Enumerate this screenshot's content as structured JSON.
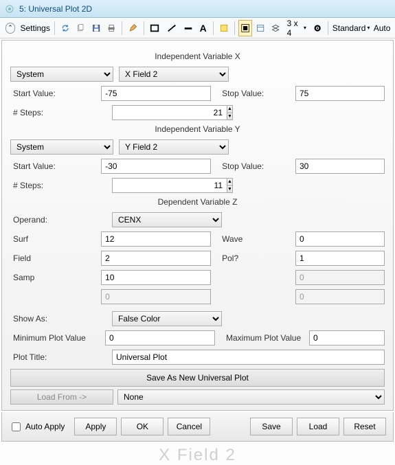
{
  "window": {
    "title": "5: Universal Plot 2D"
  },
  "toolbar": {
    "settings": "Settings",
    "grid_text": "3 x 4",
    "standard": "Standard",
    "auto": "Auto"
  },
  "varX": {
    "title": "Independent Variable X",
    "source": "System",
    "field": "X Field 2",
    "start_label": "Start Value:",
    "start": "-75",
    "stop_label": "Stop Value:",
    "stop": "75",
    "steps_label": "# Steps:",
    "steps": "21"
  },
  "varY": {
    "title": "Independent Variable Y",
    "source": "System",
    "field": "Y Field 2",
    "start_label": "Start Value:",
    "start": "-30",
    "stop_label": "Stop Value:",
    "stop": "30",
    "steps_label": "# Steps:",
    "steps": "11"
  },
  "varZ": {
    "title": "Dependent Variable Z",
    "operand_label": "Operand:",
    "operand": "CENX",
    "surf_label": "Surf",
    "surf": "12",
    "wave_label": "Wave",
    "wave": "0",
    "field_label": "Field",
    "field": "2",
    "pol_label": "Pol?",
    "pol": "1",
    "samp_label": "Samp",
    "samp": "10",
    "extra1": "0",
    "extra2": "0",
    "extra3": "0"
  },
  "display": {
    "showas_label": "Show As:",
    "showas": "False Color",
    "min_label": "Minimum Plot Value",
    "min": "0",
    "max_label": "Maximum Plot Value",
    "max": "0",
    "title_label": "Plot Title:",
    "title": "Universal Plot"
  },
  "save": {
    "save_as": "Save As New Universal Plot",
    "load_from": "Load From ->",
    "none": "None"
  },
  "footer": {
    "auto_apply": "Auto Apply",
    "apply": "Apply",
    "ok": "OK",
    "cancel": "Cancel",
    "save": "Save",
    "load": "Load",
    "reset": "Reset"
  },
  "ghost": "X Field 2"
}
